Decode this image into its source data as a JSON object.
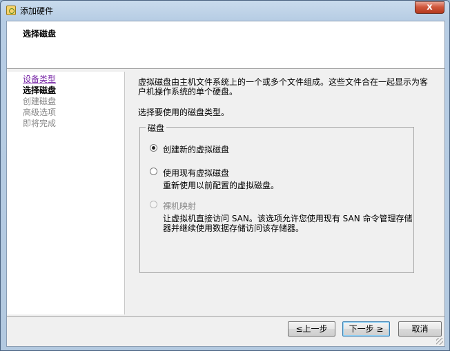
{
  "window": {
    "title": "添加硬件",
    "close_glyph": "x",
    "icon": "hardware-wizard-icon"
  },
  "header": {
    "title": "选择磁盘"
  },
  "nav": {
    "items": [
      {
        "label": "设备类型",
        "state": "link"
      },
      {
        "label": "选择磁盘",
        "state": "current"
      },
      {
        "label": "创建磁盘",
        "state": "disabled"
      },
      {
        "label": "高级选项",
        "state": "disabled"
      },
      {
        "label": "即将完成",
        "state": "disabled"
      }
    ]
  },
  "content": {
    "desc_line1": "虚拟磁盘由主机文件系统上的一个或多个文件组成。这些文件合在一起显示为客",
    "desc_line2": "户机操作系统的单个硬盘。",
    "prompt": "选择要使用的磁盘类型。",
    "group_label": "磁盘",
    "options": [
      {
        "label": "创建新的虚拟磁盘",
        "selected": true,
        "enabled": true,
        "desc": ""
      },
      {
        "label": "使用现有虚拟磁盘",
        "selected": false,
        "enabled": true,
        "desc": "重新使用以前配置的虚拟磁盘。"
      },
      {
        "label": "裸机映射",
        "selected": false,
        "enabled": false,
        "desc_line1": "让虚拟机直接访问 SAN。该选项允许您使用现有 SAN 命令管理存储",
        "desc_line2": "器并继续使用数据存储访问该存储器。"
      }
    ]
  },
  "buttons": {
    "back": "≤上一步",
    "next": "下一步 ≥",
    "cancel": "取消"
  }
}
